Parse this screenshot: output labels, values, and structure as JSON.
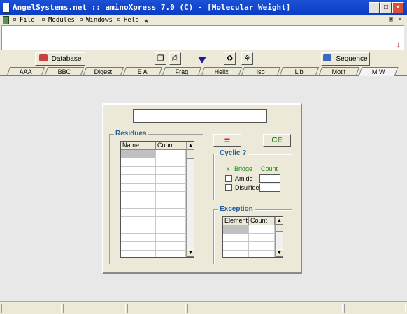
{
  "window": {
    "title": "AngelSystems.net :: aminoXpress 7.0 (C) - [Molecular Weight]"
  },
  "menu": {
    "items": [
      "File",
      "Modules",
      "Windows",
      "Help"
    ]
  },
  "toolbar": {
    "database_label": "Database",
    "sequence_label": "Sequence"
  },
  "tabs": [
    "AAA",
    "BBC",
    "Digest",
    "E A",
    "Frag",
    "Helix",
    "Iso",
    "Lib",
    "Motif",
    "M W"
  ],
  "active_tab": "M W",
  "residues": {
    "legend": "Residues",
    "columns": [
      "Name",
      "Count"
    ]
  },
  "buttons": {
    "equals_label": "=",
    "ce_label": "CE"
  },
  "cyclic": {
    "legend": "Cyclic ?",
    "header_mark": "x",
    "header_bridge": "Bridge",
    "header_count": "Count",
    "amide_label": "Amide",
    "disulfide_label": "Disulfide"
  },
  "exception": {
    "legend": "Exception",
    "columns": [
      "Element",
      "Count"
    ]
  },
  "colors": {
    "titlebar": "#0a3cc4",
    "legend_text": "#1f5e9e",
    "equals_red": "#e02020",
    "ce_green": "#1a7a1a",
    "cyclic_green": "#1a8a1a"
  }
}
